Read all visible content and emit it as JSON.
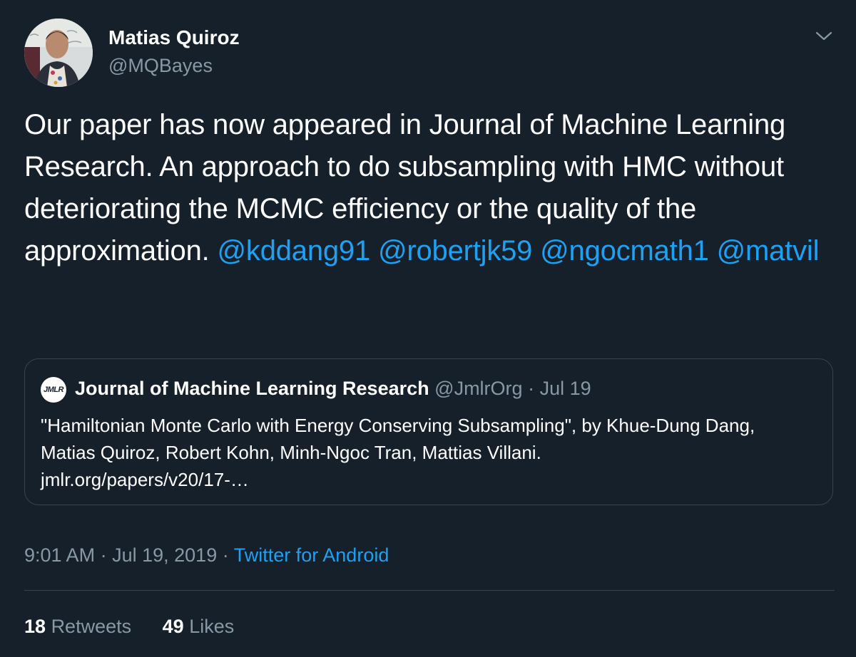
{
  "author": {
    "name": "Matias Quiroz",
    "handle": "@MQBayes"
  },
  "tweet": {
    "text": "Our paper has now appeared in Journal of Machine Learning Research. An approach to do subsampling with HMC without deteriorating the MCMC efficiency or the quality of the approximation.",
    "mentions": [
      "@kddang91",
      "@robertjk59",
      "@ngocmath1",
      "@matvil"
    ]
  },
  "quote": {
    "logo_text": "JMLR",
    "name": "Journal of Machine Learning Research",
    "handle": "@JmlrOrg",
    "separator": "·",
    "date": "Jul 19",
    "text": "\"Hamiltonian Monte Carlo with Energy Conserving Subsampling\", by Khue-Dung Dang, Matias Quiroz, Robert Kohn, Minh-Ngoc Tran, Mattias Villani.",
    "link": "jmlr.org/papers/v20/17-…"
  },
  "meta": {
    "time": "9:01 AM",
    "separator": "·",
    "date": "Jul 19, 2019",
    "source": "Twitter for Android"
  },
  "stats": {
    "retweets_count": "18",
    "retweets_label": "Retweets",
    "likes_count": "49",
    "likes_label": "Likes"
  },
  "colors": {
    "background": "#15202b",
    "accent": "#1da1f2",
    "muted": "#8899a6",
    "border": "#38444d"
  },
  "icons": {
    "menu": "chevron-down-icon"
  }
}
